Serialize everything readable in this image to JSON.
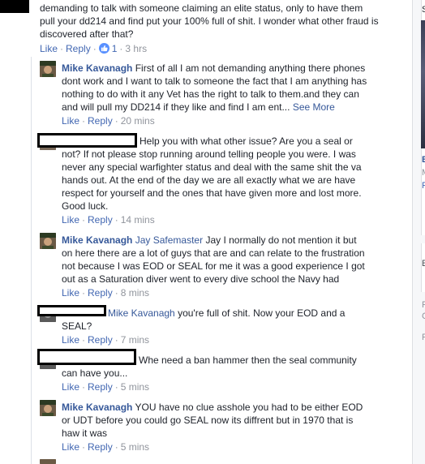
{
  "thread": {
    "top_comment": {
      "line1": "demanding to talk with someone claiming an elite status, only to have them",
      "line2": "pull your dd214 and find put your 100% full of shit. I wonder what other fraud is",
      "line3": "discovered after that?",
      "like_label": "Like",
      "reply_label": "Reply",
      "reaction_count": "1",
      "time": "3 hrs"
    },
    "replies": [
      {
        "author": "Mike Kavanagh",
        "lines": [
          "First of all I am not demanding anything there phones",
          "dont work and I want to talk to someone the fact that I am anything has",
          "nothing to do with it any Vet has the right to talk to them.and they can",
          "and will pull my DD214 if they like and find I am ent..."
        ],
        "see_more": "See More",
        "like_label": "Like",
        "reply_label": "Reply",
        "time": "20 mins"
      },
      {
        "author": "",
        "lines": [
          "Help you with what other issue? Are you a seal or",
          "not? If not please stop running around telling people you were. I was",
          "never any special warfighter status and deal with the same shit the va",
          "hands out. At the end of the day we are all exactly what we are have",
          "respect for yourself and the ones that have given more and lost more.",
          "Good luck."
        ],
        "like_label": "Like",
        "reply_label": "Reply",
        "time": "14 mins"
      },
      {
        "author": "Mike Kavanagh",
        "tagged": "Jay Safemaster",
        "lines": [
          "Jay I normally do not mention it but",
          "on here there are a lot of guys that are and can relate to the frustration",
          "not because I was EOD or SEAL for me it was a good experience I got",
          "out as a Saturation diver went to every dive school the Navy had"
        ],
        "like_label": "Like",
        "reply_label": "Reply",
        "time": "8 mins"
      },
      {
        "tagged": "Mike Kavanagh",
        "lines": [
          "you're full of shit. Now your EOD and a",
          "SEAL?"
        ],
        "like_label": "Like",
        "reply_label": "Reply",
        "time": "7 mins"
      },
      {
        "lines": [
          "Whe need a ban hammer then the seal community",
          "can have you..."
        ],
        "like_label": "Like",
        "reply_label": "Reply",
        "time": "5 mins"
      },
      {
        "author": "Mike Kavanagh",
        "lines": [
          "YOU have no clue asshole you had to be either EOD",
          "or UDT before you could go SEAL now its diffrent but in 1970 that is",
          "haw it was"
        ],
        "like_label": "Like",
        "reply_label": "Reply",
        "time": "5 mins"
      }
    ]
  },
  "side": {
    "frag_s": "S",
    "frag_e": "E",
    "frag_m": "M",
    "frag_f": "F",
    "frag_e2": "E",
    "frag_f2": "F",
    "frag_c": "C",
    "frag_f3": "F"
  },
  "colors": {
    "link": "#4267b2",
    "name": "#365899",
    "meta": "#90949c",
    "like_badge": "#5890ff"
  },
  "icons": {
    "like_badge": "thumbs-up-icon"
  }
}
